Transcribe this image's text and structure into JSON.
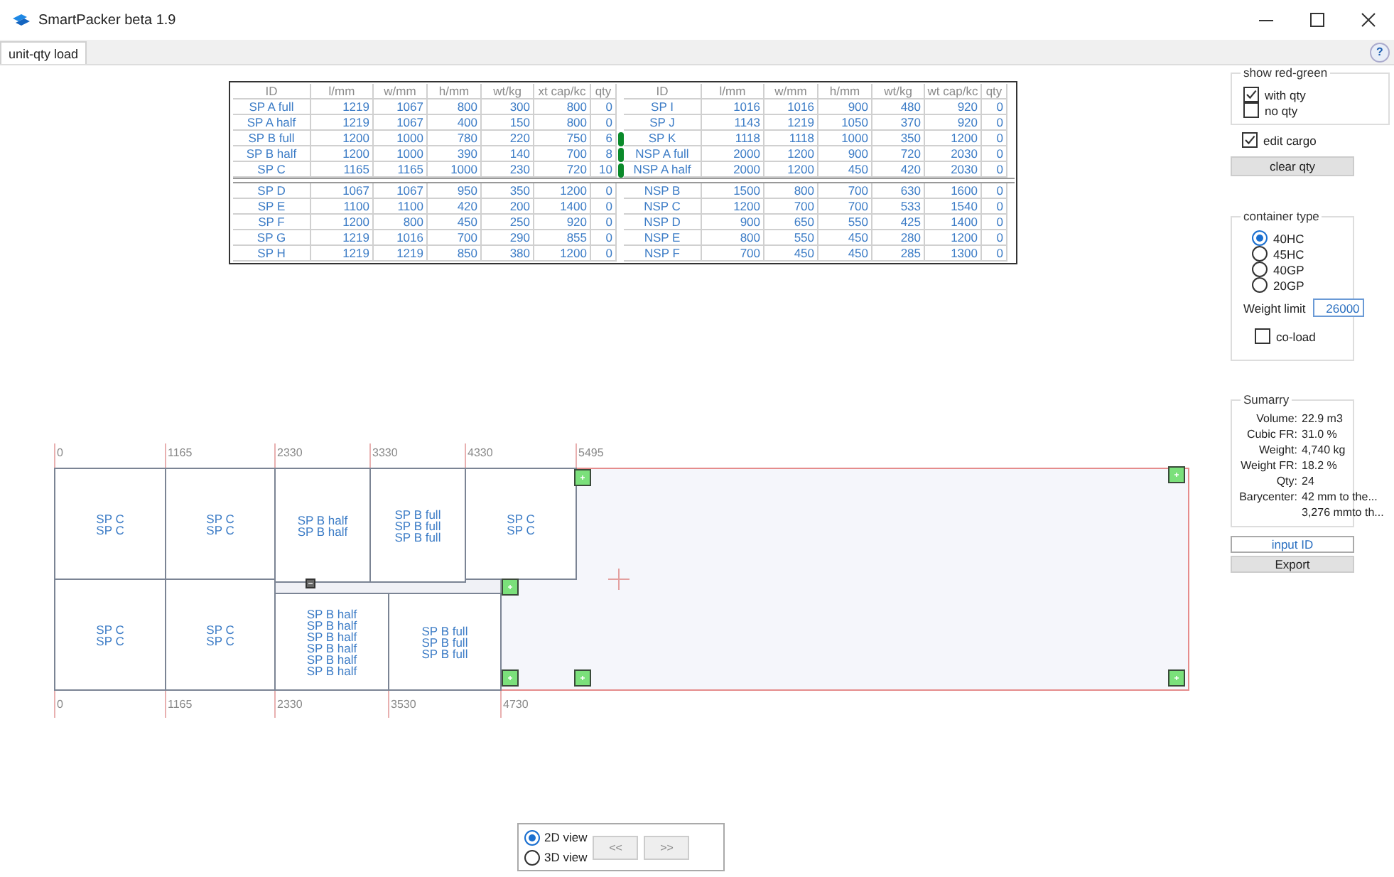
{
  "window": {
    "title": "SmartPacker beta 1.9"
  },
  "tabs": [
    {
      "label": "unit-qty load",
      "selected": true
    }
  ],
  "help_button": "?",
  "cargo_tables": [
    {
      "columns": [
        "ID",
        "l/mm",
        "w/mm",
        "h/mm",
        "wt/kg",
        "xt cap/kc",
        "qty"
      ],
      "groups": [
        [
          {
            "cells": [
              "SP A full",
              "1219",
              "1067",
              "800",
              "300",
              "800",
              "0"
            ],
            "marked": false
          },
          {
            "cells": [
              "SP A half",
              "1219",
              "1067",
              "400",
              "150",
              "800",
              "0"
            ],
            "marked": false
          },
          {
            "cells": [
              "SP B full",
              "1200",
              "1000",
              "780",
              "220",
              "750",
              "6"
            ],
            "marked": true
          },
          {
            "cells": [
              "SP B half",
              "1200",
              "1000",
              "390",
              "140",
              "700",
              "8"
            ],
            "marked": true
          },
          {
            "cells": [
              "SP C",
              "1165",
              "1165",
              "1000",
              "230",
              "720",
              "10"
            ],
            "marked": true
          }
        ],
        [
          {
            "cells": [
              "SP D",
              "1067",
              "1067",
              "950",
              "350",
              "1200",
              "0"
            ],
            "marked": false
          },
          {
            "cells": [
              "SP E",
              "1100",
              "1100",
              "420",
              "200",
              "1400",
              "0"
            ],
            "marked": false
          },
          {
            "cells": [
              "SP F",
              "1200",
              "800",
              "450",
              "250",
              "920",
              "0"
            ],
            "marked": false
          },
          {
            "cells": [
              "SP G",
              "1219",
              "1016",
              "700",
              "290",
              "855",
              "0"
            ],
            "marked": false
          },
          {
            "cells": [
              "SP H",
              "1219",
              "1219",
              "850",
              "380",
              "1200",
              "0"
            ],
            "marked": false
          }
        ]
      ]
    },
    {
      "columns": [
        "ID",
        "l/mm",
        "w/mm",
        "h/mm",
        "wt/kg",
        "wt cap/kc",
        "qty"
      ],
      "groups": [
        [
          {
            "cells": [
              "SP I",
              "1016",
              "1016",
              "900",
              "480",
              "920",
              "0"
            ],
            "marked": false
          },
          {
            "cells": [
              "SP J",
              "1143",
              "1219",
              "1050",
              "370",
              "920",
              "0"
            ],
            "marked": false
          },
          {
            "cells": [
              "SP K",
              "1118",
              "1118",
              "1000",
              "350",
              "1200",
              "0"
            ],
            "marked": false
          },
          {
            "cells": [
              "NSP A full",
              "2000",
              "1200",
              "900",
              "720",
              "2030",
              "0"
            ],
            "marked": false
          },
          {
            "cells": [
              "NSP A half",
              "2000",
              "1200",
              "450",
              "420",
              "2030",
              "0"
            ],
            "marked": false
          }
        ],
        [
          {
            "cells": [
              "NSP B",
              "1500",
              "800",
              "700",
              "630",
              "1600",
              "0"
            ],
            "marked": false
          },
          {
            "cells": [
              "NSP C",
              "1200",
              "700",
              "700",
              "533",
              "1540",
              "0"
            ],
            "marked": false
          },
          {
            "cells": [
              "NSP D",
              "900",
              "650",
              "550",
              "425",
              "1400",
              "0"
            ],
            "marked": false
          },
          {
            "cells": [
              "NSP E",
              "800",
              "550",
              "450",
              "280",
              "1200",
              "0"
            ],
            "marked": false
          },
          {
            "cells": [
              "NSP F",
              "700",
              "450",
              "450",
              "285",
              "1300",
              "0"
            ],
            "marked": false
          }
        ]
      ]
    }
  ],
  "diagram": {
    "top_ruler": [
      "0",
      "1165",
      "2330",
      "3330",
      "4330",
      "5495"
    ],
    "bottom_ruler": [
      "0",
      "1165",
      "2330",
      "3530",
      "4730"
    ],
    "top_row": [
      {
        "labels": [
          "SP C",
          "SP C"
        ]
      },
      {
        "labels": [
          "SP C",
          "SP C"
        ]
      },
      {
        "labels": [
          "SP B half",
          "SP B half"
        ]
      },
      {
        "labels": [
          "SP B full",
          "SP B full",
          "SP B full"
        ]
      },
      {
        "labels": [
          "SP C",
          "SP C"
        ]
      }
    ],
    "bottom_row": [
      {
        "labels": [
          "SP C",
          "SP C"
        ]
      },
      {
        "labels": [
          "SP C",
          "SP C"
        ]
      },
      {
        "labels": [
          "SP B half",
          "SP B half",
          "SP B half",
          "SP B half",
          "SP B half",
          "SP B half"
        ]
      },
      {
        "labels": [
          "SP B full",
          "SP B full",
          "SP B full"
        ]
      }
    ]
  },
  "view": {
    "options": [
      {
        "label": "2D view",
        "selected": true
      },
      {
        "label": "3D view",
        "selected": false
      }
    ],
    "buttons": [
      "<<",
      ">>"
    ]
  },
  "side": {
    "red_green": {
      "title": "show red-green",
      "options": [
        {
          "label": "with qty",
          "checked": true
        },
        {
          "label": "no qty",
          "checked": false
        }
      ]
    },
    "edit_cargo": {
      "label": "edit cargo",
      "checked": true
    },
    "clear_button": "clear qty",
    "container_type": {
      "title": "container type",
      "options": [
        {
          "label": "40HC",
          "selected": true
        },
        {
          "label": "45HC",
          "selected": false
        },
        {
          "label": "40GP",
          "selected": false
        },
        {
          "label": "20GP",
          "selected": false
        }
      ],
      "weight_limit": {
        "label": "Weight limit",
        "value": "26000"
      },
      "co_load": {
        "label": "co-load",
        "checked": false
      }
    },
    "summary": {
      "title": "Sumarry",
      "rows": [
        {
          "label": "Volume:",
          "value": "22.9 m3"
        },
        {
          "label": "Cubic FR:",
          "value": "31.0 %"
        },
        {
          "label": "Weight:",
          "value": "4,740 kg"
        },
        {
          "label": "Weight FR:",
          "value": "18.2 %"
        },
        {
          "label": "Qty:",
          "value": "24"
        },
        {
          "label": "Barycenter:",
          "value": "42 mm to the..."
        },
        {
          "value": "3,276 mmto th..."
        }
      ]
    },
    "input_id": {
      "placeholder": "input ID"
    },
    "export_button": "Export"
  }
}
